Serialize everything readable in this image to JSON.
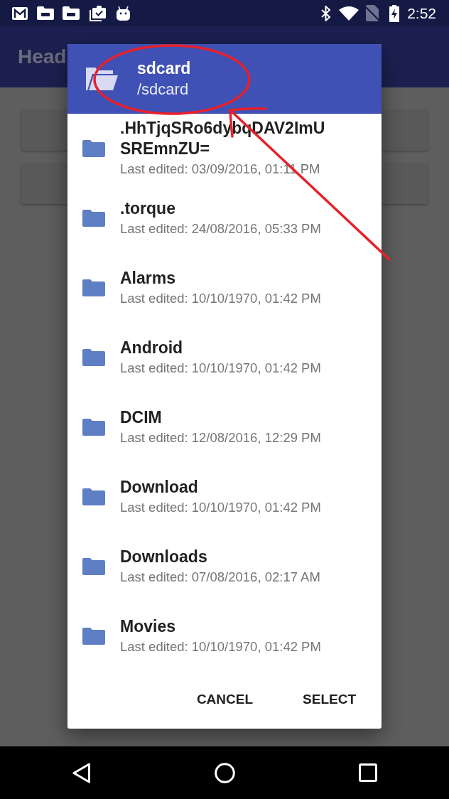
{
  "status_bar": {
    "time": "2:52"
  },
  "app_bar": {
    "title": "Head"
  },
  "dialog": {
    "title": "sdcard",
    "path": "/sdcard",
    "folders": [
      {
        "name": ".HhTjqSRo6dybqDAV2ImUSREmnZU=",
        "modified": "Last edited: 03/09/2016, 01:11 PM"
      },
      {
        "name": ".torque",
        "modified": "Last edited: 24/08/2016, 05:33 PM"
      },
      {
        "name": "Alarms",
        "modified": "Last edited: 10/10/1970, 01:42 PM"
      },
      {
        "name": "Android",
        "modified": "Last edited: 10/10/1970, 01:42 PM"
      },
      {
        "name": "DCIM",
        "modified": "Last edited: 12/08/2016, 12:29 PM"
      },
      {
        "name": "Download",
        "modified": "Last edited: 10/10/1970, 01:42 PM"
      },
      {
        "name": "Downloads",
        "modified": "Last edited: 07/08/2016, 02:17 AM"
      },
      {
        "name": "Movies",
        "modified": "Last edited: 10/10/1970, 01:42 PM"
      }
    ],
    "buttons": [
      "CANCEL",
      "SELECT"
    ]
  }
}
